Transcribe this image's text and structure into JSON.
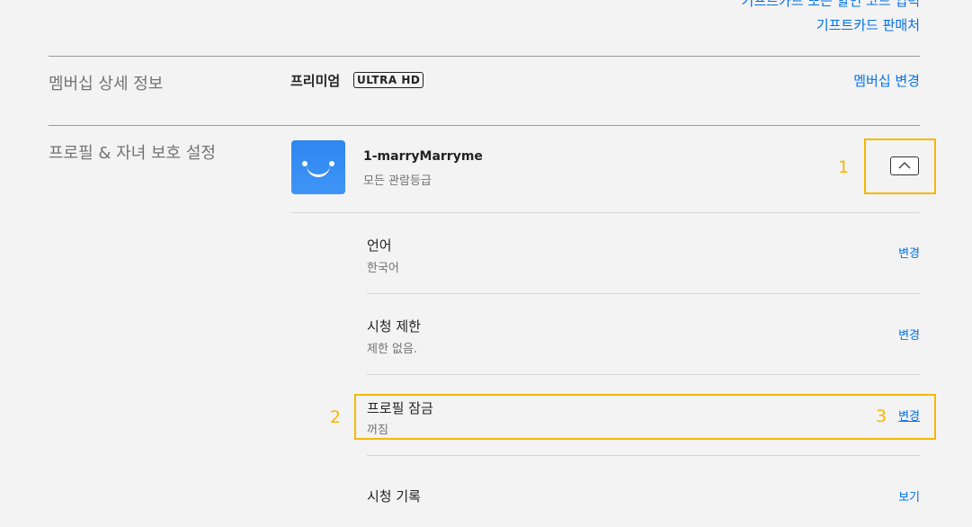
{
  "top_links": {
    "partial_link": "기프트카드 또는 할인 코드 입력",
    "gift_card_purchase": "기프트카드 판매처"
  },
  "membership": {
    "section_title": "멤버십 상세 정보",
    "plan_name": "프리미엄",
    "plan_badge_ultra": "ULTRA",
    "plan_badge_hd": "HD",
    "change_label": "멤버십 변경"
  },
  "profile_section": {
    "section_title": "프로필 & 자녀 보호 설정",
    "profile": {
      "name": "1-marryMarryme",
      "rating": "모든 관람등급"
    },
    "settings": [
      {
        "label": "언어",
        "value": "한국어",
        "action": "변경"
      },
      {
        "label": "시청 제한",
        "value": "제한 없음.",
        "action": "변경"
      },
      {
        "label": "프로필 잠금",
        "value": "꺼짐",
        "action": "변경"
      },
      {
        "label": "시청 기록",
        "value": "",
        "action": "보기"
      }
    ]
  },
  "annotations": [
    "1",
    "2",
    "3"
  ],
  "colors": {
    "background": "#f3f3f3",
    "link": "#0071eb",
    "annotation": "#f5b800",
    "avatar": "#2e86f0"
  }
}
